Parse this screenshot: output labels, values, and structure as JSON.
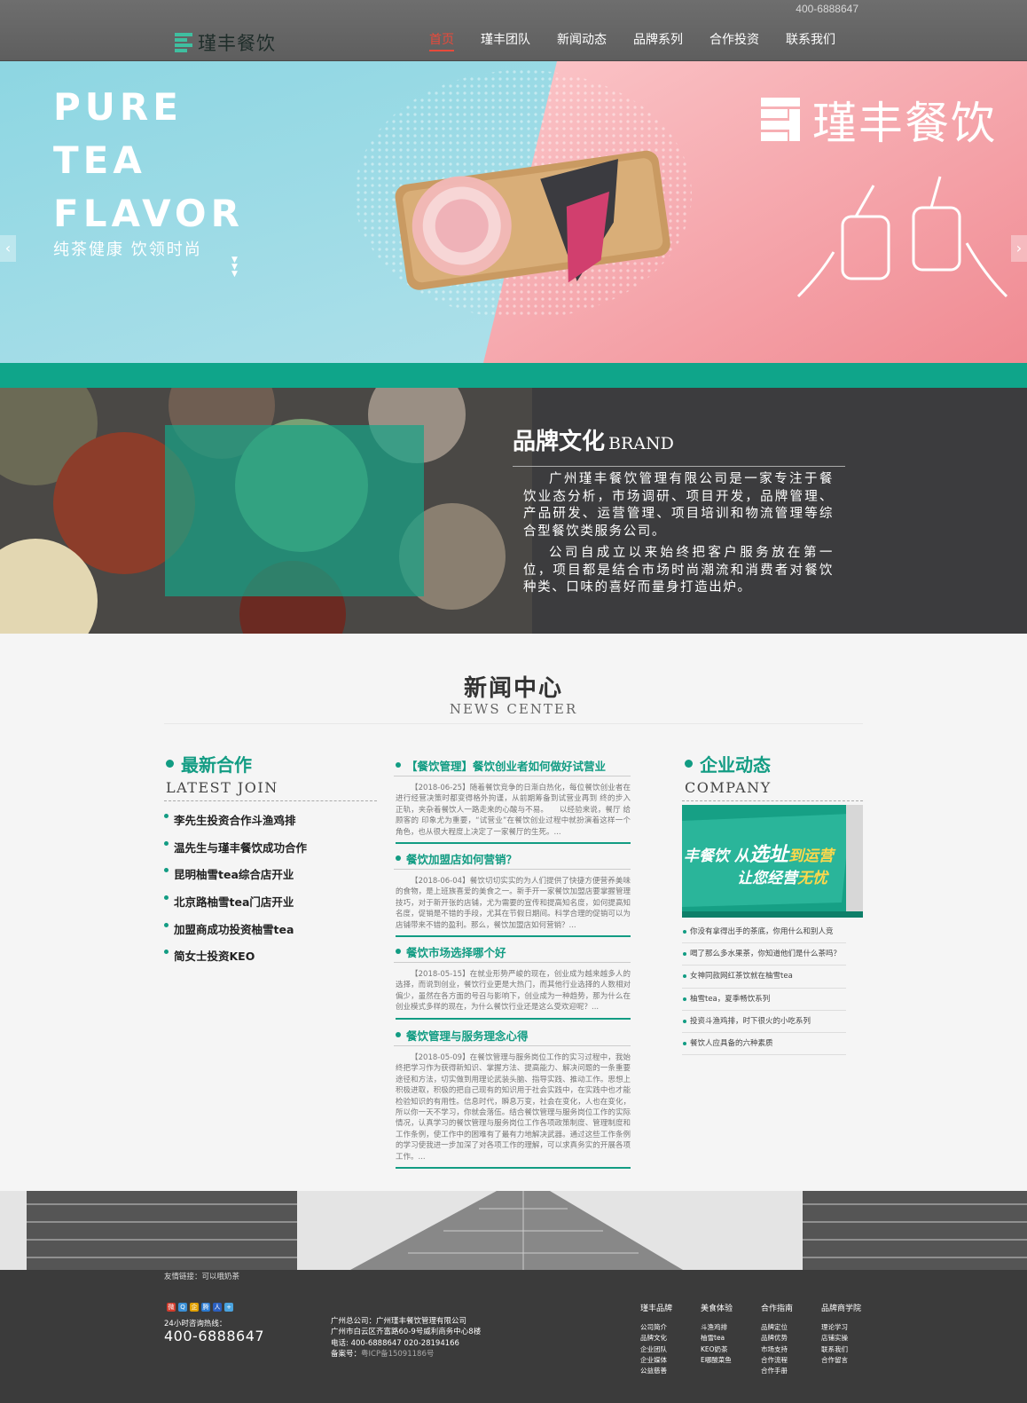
{
  "header": {
    "hotline": "400-6888647",
    "logo_text": "瑾丰餐饮",
    "nav": [
      "首页",
      "瑾丰团队",
      "新闻动态",
      "品牌系列",
      "合作投资",
      "联系我们"
    ]
  },
  "banner": {
    "line1": "PURE",
    "line2": "TEA",
    "line3": "FLAVOR",
    "slogan": "纯茶健康 饮领时尚",
    "brand_text": "瑾丰餐饮",
    "prev": "‹",
    "next": "›"
  },
  "brand": {
    "title": "品牌文化",
    "title_en": "BRAND",
    "p1": "广州瑾丰餐饮管理有限公司是一家专注于餐饮业态分析，市场调研、项目开发，品牌管理、产品研发、运营管理、项目培训和物流管理等综合型餐饮类服务公司。",
    "p2": "公司自成立以来始终把客户服务放在第一位，项目都是结合市场时尚潮流和消费者对餐饮种类、口味的喜好而量身打造出炉。"
  },
  "news": {
    "title": "新闻中心",
    "title_en": "NEWS CENTER",
    "latest": {
      "title": "最新合作",
      "title_en": "LATEST JOIN",
      "items": [
        "李先生投资合作斗渔鸡排",
        "温先生与瑾丰餐饮成功合作",
        "昆明柚雪tea综合店开业",
        "北京路柚雪tea门店开业",
        "加盟商成功投资柚雪tea",
        "简女士投资KEO"
      ]
    },
    "articles": [
      {
        "title": "【餐饮管理】餐饮创业者如何做好试营业",
        "body": "【2018-06-25】随着餐饮竞争的日渐白热化，每位餐饮创业者在进行经营决策时都变得格外拘谨，从前期筹备到试营业再到 终的步入正轨，夹杂着餐饮人一路走来的心酸与不易。　　以经验来说，餐厅 给顾客的 印象尤为重要，“试营业”在餐饮创业过程中就扮演着这样一个角色，也从很大程度上决定了一家餐厅的生死。..."
      },
      {
        "title": "餐饮加盟店如何营销？",
        "body": "【2018-06-04】餐饮切切实实的为人们提供了快捷方便营养美味的食物，是上班族喜爱的美食之一。新手开一家餐饮加盟店要掌握管理技巧，对于新开张的店铺，尤为需要的宣传和提高知名度，如何提高知名度，促销是不错的手段，尤其在节假日期间。科学合理的促销可以为店铺带来不错的盈利。那么，餐饮加盟店如何营销？..."
      },
      {
        "title": "餐饮市场选择哪个好",
        "body": "【2018-05-15】在就业形势严峻的现在，创业成为越来越多人的选择，而说到创业，餐饮行业更是大热门，而其他行业选择的人数相对偏少，虽然在各方面的号召与影响下，创业成为一种趋势，那为什么在创业模式多样的现在，为什么餐饮行业还是这么受欢迎呢？..."
      },
      {
        "title": "餐饮管理与服务理念心得",
        "body": "【2018-05-09】在餐饮管理与服务岗位工作的实习过程中，我始终把学习作为获得新知识、掌握方法、提高能力、解决问题的一条重要途径和方法，切实做到用理论武装头脑、指导实践、推动工作。思想上积极进取，积极的把自己现有的知识用于社会实践中，在实践中也才能检验知识的有用性。信息时代，瞬息万变，社会在变化，人也在变化，所以你一天不学习，你就会落伍。结合餐饮管理与服务岗位工作的实际情况，认真学习的餐饮管理与服务岗位工作各项政策制度、管理制度和工作条例，使工作中的困难有了最有力地解决武器。通过这些工作条例的学习使我进一步加深了对各项工作的理解，可以求真务实的开展各项工作。..."
      }
    ],
    "company": {
      "title": "企业动态",
      "title_en": "COMPANY",
      "img_line1a": "丰餐饮 从",
      "img_line1b": "选址",
      "img_line1c": "到运营",
      "img_line2a": "让您经营",
      "img_line2b": "无忧",
      "items": [
        "你没有拿得出手的茶底，你用什么和别人竞",
        "喝了那么多水果茶，你知道他们是什么茶吗？",
        "女神同款网红茶饮就在柚雪tea",
        "柚雪tea，夏季畅饮系列",
        "投资斗渔鸡排，时下很火的小吃系列",
        "餐饮人应具备的六种素质"
      ]
    }
  },
  "footer": {
    "friend_links": "友情链接：可以哦奶茶",
    "hotline_label": "24小时咨询热线：",
    "hotline": "400-6888647",
    "addr1": "广州总公司：广州瑾丰餐饮管理有限公司",
    "addr2": "广州市白云区齐富路60-9号威利商务中心8楼",
    "phone": "电话: 400-6888647 020-28194166",
    "icp_label": "备案号：",
    "icp": "粤ICP备15091186号",
    "columns": [
      {
        "title": "瑾丰品牌",
        "items": [
          "公司简介",
          "品牌文化",
          "企业团队",
          "企业媒体",
          "公益慈善"
        ]
      },
      {
        "title": "美食体验",
        "items": [
          "斗渔鸡排",
          "柚雪tea",
          "KEO奶茶",
          "E哪酸菜鱼"
        ]
      },
      {
        "title": "合作指南",
        "items": [
          "品牌定位",
          "品牌优势",
          "市场支持",
          "合作流程",
          "合作手册"
        ]
      },
      {
        "title": "品牌商学院",
        "items": [
          "理论学习",
          "店铺实操",
          "联系我们",
          "合作留言"
        ]
      }
    ]
  }
}
